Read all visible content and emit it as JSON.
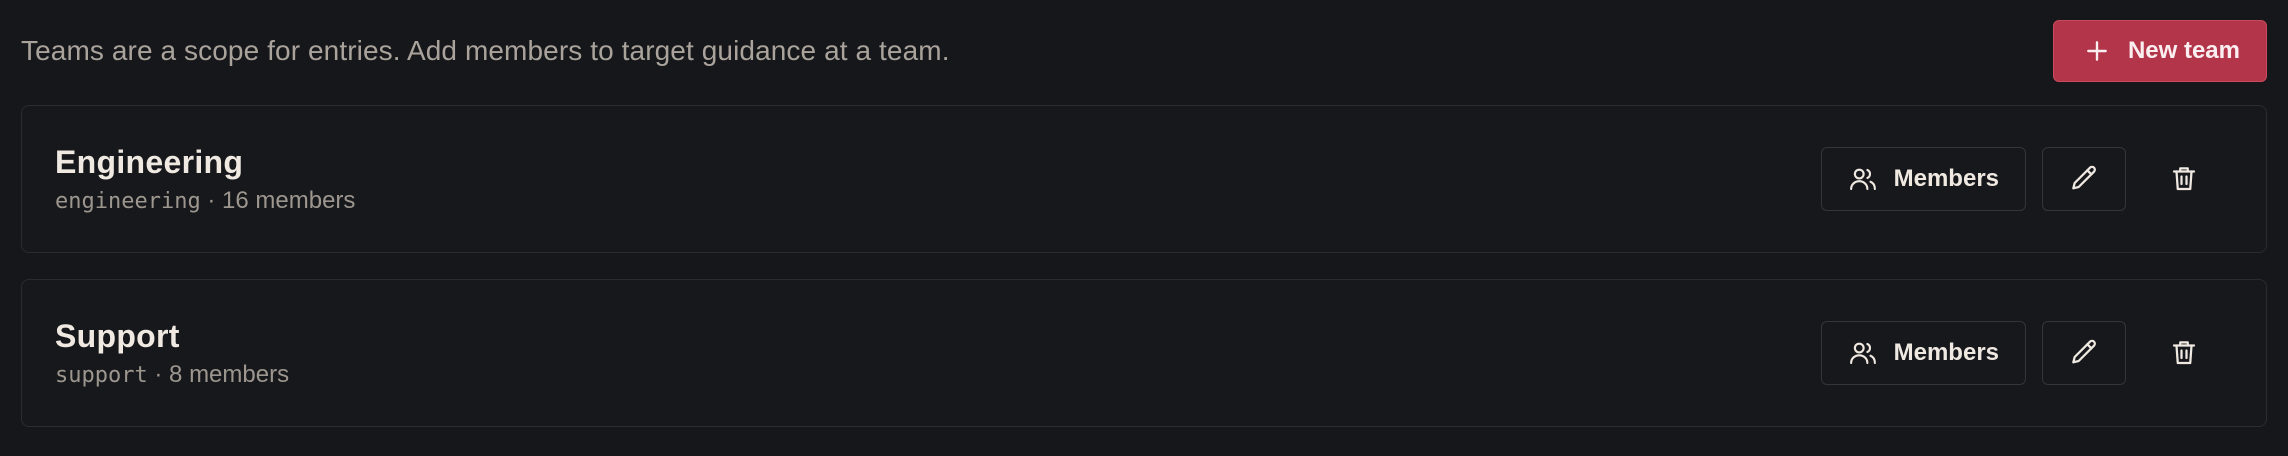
{
  "header": {
    "description": "Teams are a scope for entries. Add members to target guidance at a team.",
    "new_team_label": "New team"
  },
  "teams": [
    {
      "name": "Engineering",
      "slug": "engineering",
      "separator": " · ",
      "members": "16 members",
      "members_button": "Members"
    },
    {
      "name": "Support",
      "slug": "support",
      "separator": " · ",
      "members": "8 members",
      "members_button": "Members"
    }
  ],
  "icons": {
    "new_team": "plus-icon",
    "members": "users-icon",
    "edit": "pencil-icon",
    "delete": "trash-icon"
  },
  "colors": {
    "background": "#16171b",
    "accent": "#b23549",
    "text": "#ece7df",
    "muted": "#a9a39b"
  }
}
